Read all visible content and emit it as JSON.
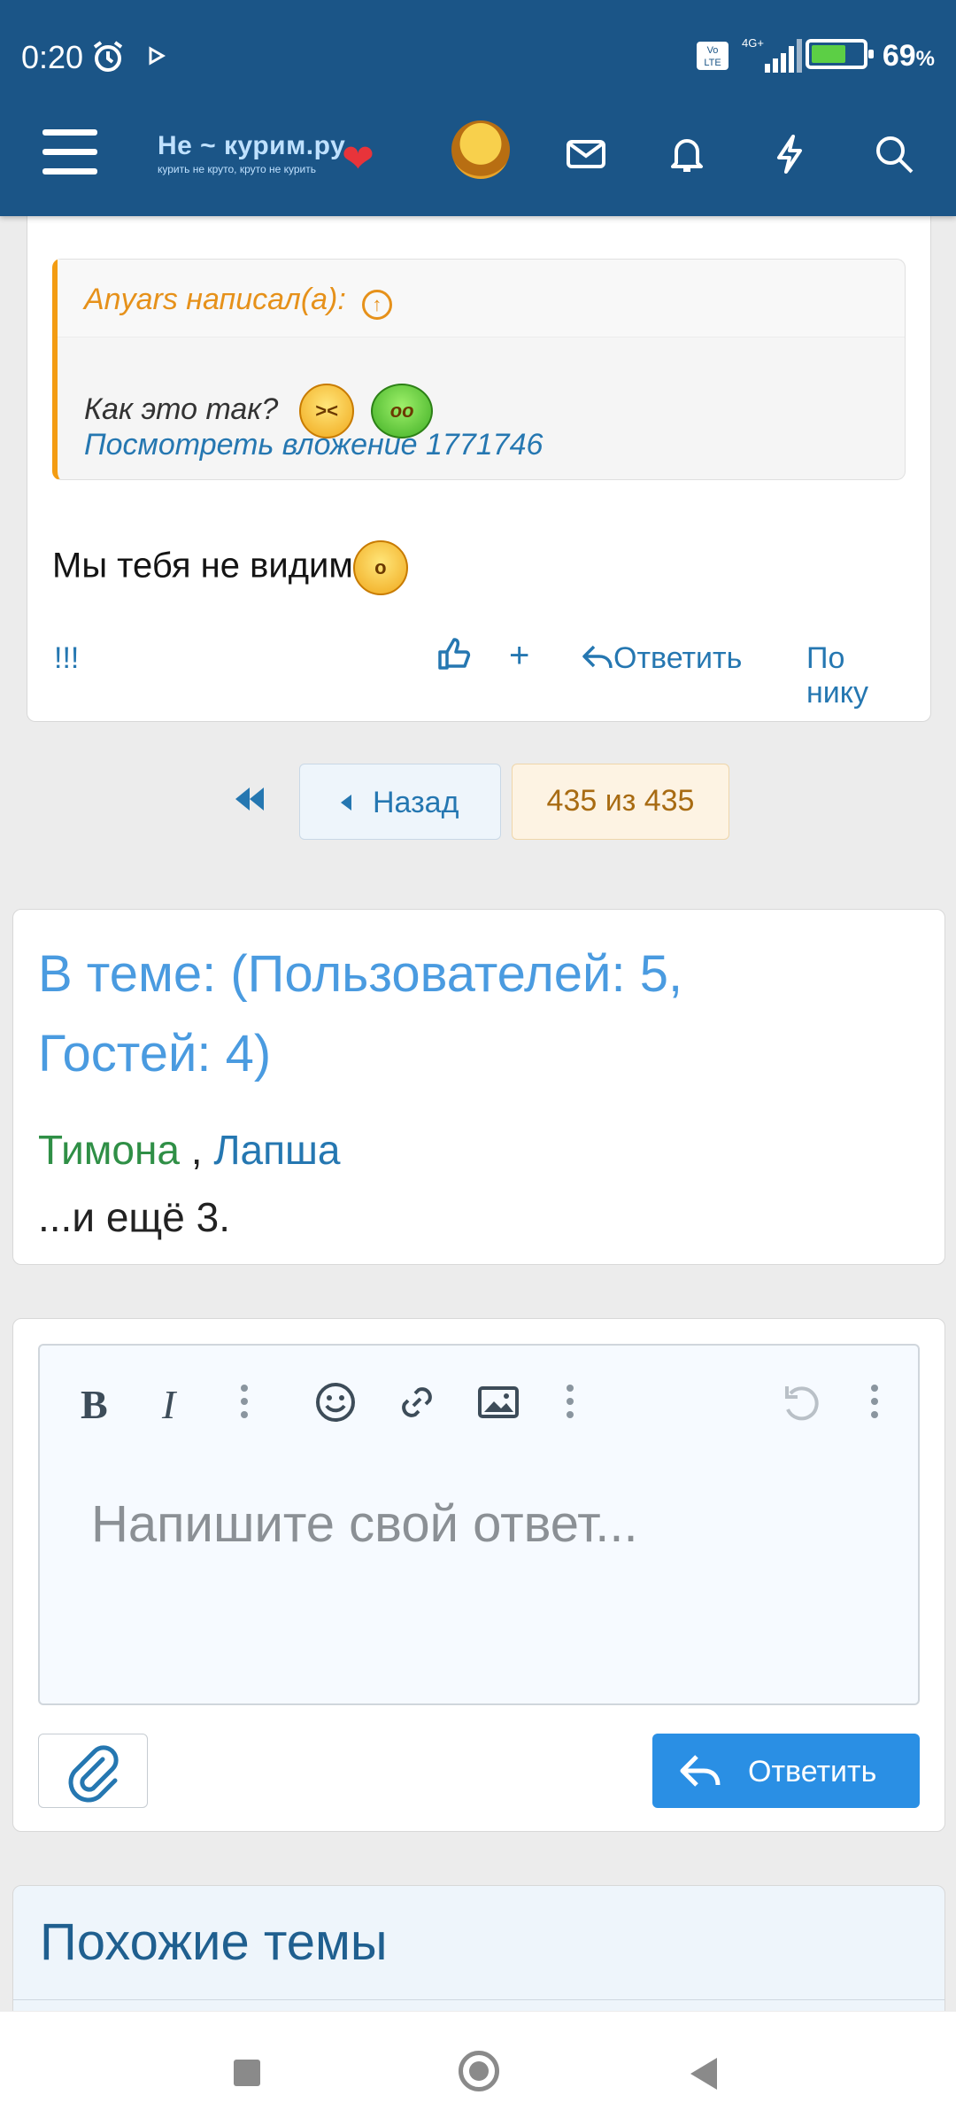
{
  "status_bar": {
    "time": "0:20",
    "network": "4G+",
    "volte": "Vo LTE",
    "battery_pct": "69",
    "battery_unit": "%"
  },
  "header": {
    "logo_text": "Не ~ курим.ру",
    "logo_tagline": "курить не круто, круто не курить"
  },
  "quote": {
    "author": "Anyars написал(а):",
    "text": "Как это так?",
    "attachment_link": "Посмотреть вложение 1771746"
  },
  "post": {
    "body": "Мы тебя не видим",
    "actions": {
      "report": "!!!",
      "plus": "+",
      "reply": "Ответить",
      "by_nick": "По нику"
    }
  },
  "pager": {
    "back": "Назад",
    "current": "435 из 435"
  },
  "online": {
    "title": "В теме: (Пользователей: 5, Гостей: 4)",
    "user1": "Тимона",
    "separator": " , ",
    "user2": "Лапша",
    "more": "...и ещё 3."
  },
  "editor": {
    "placeholder": "Напишите свой ответ...",
    "reply_button": "Ответить"
  },
  "similar": {
    "title": "Похожие темы"
  },
  "colors": {
    "header_bg": "#1b5587",
    "accent_blue": "#2577b1",
    "quote_border": "#f39c12",
    "reply_button": "#2a8fe4"
  }
}
